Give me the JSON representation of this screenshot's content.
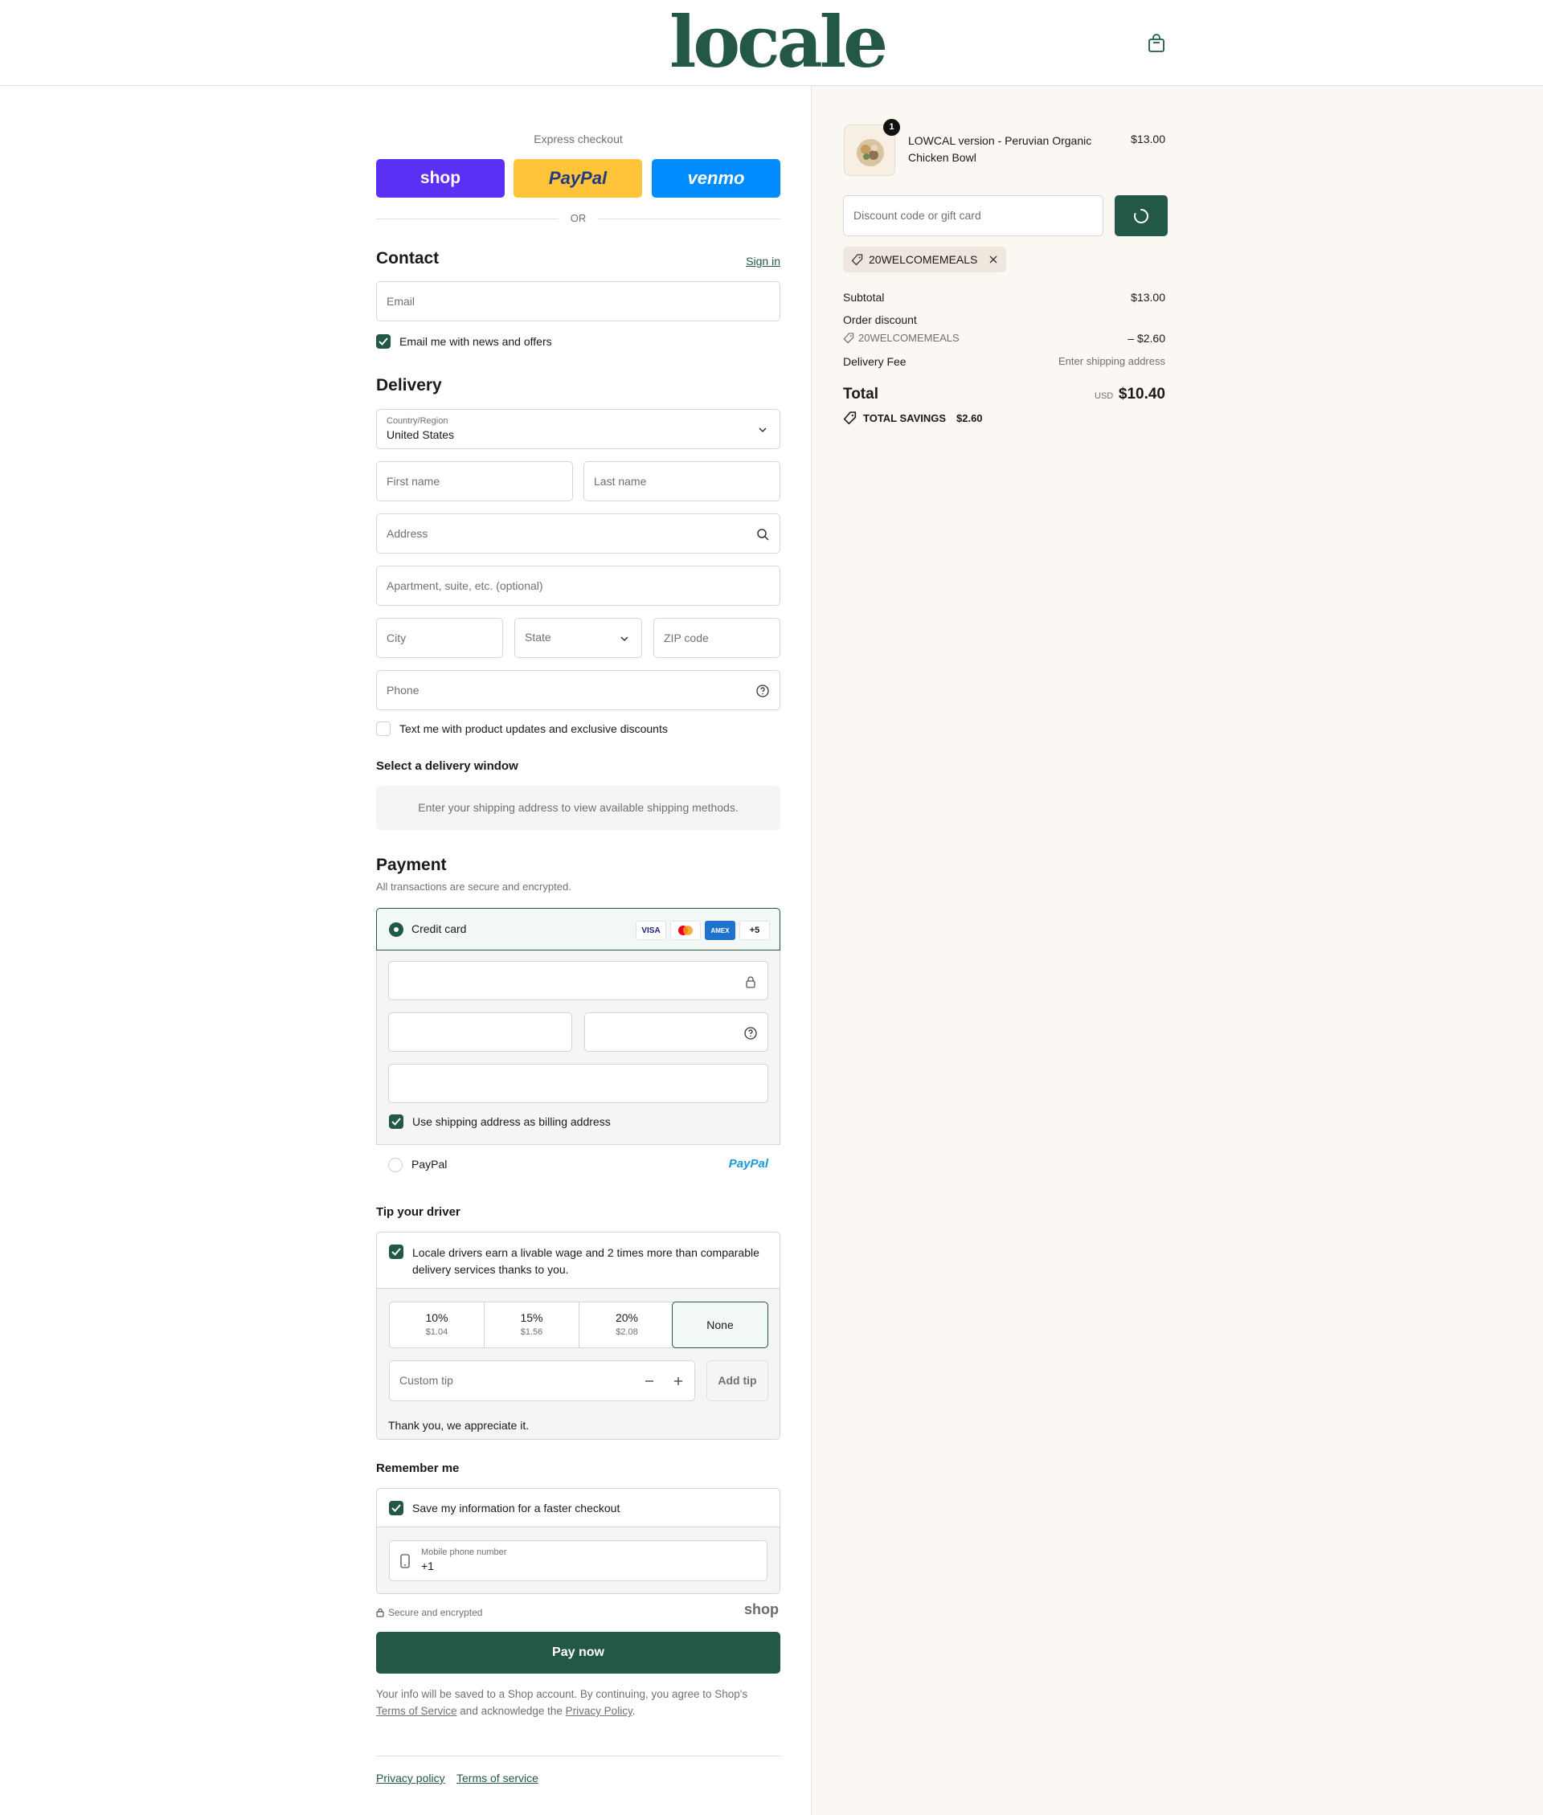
{
  "header": {
    "logo": "locale",
    "cart_icon": "shopping-bag-icon"
  },
  "express": {
    "label": "Express checkout",
    "shop": "shop",
    "paypal": "PayPal",
    "venmo": "venmo",
    "or": "OR"
  },
  "contact": {
    "title": "Contact",
    "sign_in": "Sign in",
    "email_placeholder": "Email",
    "news_label": "Email me with news and offers",
    "news_checked": true
  },
  "delivery": {
    "title": "Delivery",
    "country_label": "Country/Region",
    "country_value": "United States",
    "first_name": "First name",
    "last_name": "Last name",
    "address": "Address",
    "apartment": "Apartment, suite, etc. (optional)",
    "city": "City",
    "state": "State",
    "zip": "ZIP code",
    "phone": "Phone",
    "text_label": "Text me with product updates and exclusive discounts",
    "window_title": "Select a delivery window",
    "window_notice": "Enter your shipping address to view available shipping methods."
  },
  "payment": {
    "title": "Payment",
    "subtitle": "All transactions are secure and encrypted.",
    "credit_card": "Credit card",
    "card_logos": [
      "VISA",
      "AMEX",
      "+5"
    ],
    "billing_label": "Use shipping address as billing address",
    "paypal_label": "PayPal",
    "paypal_logo": "PayPal"
  },
  "tip": {
    "title": "Tip your driver",
    "message": "Locale drivers earn a livable wage and 2 times more than comparable delivery services thanks to you.",
    "options": [
      {
        "pct": "10%",
        "amt": "$1.04"
      },
      {
        "pct": "15%",
        "amt": "$1.56"
      },
      {
        "pct": "20%",
        "amt": "$2.08"
      }
    ],
    "none": "None",
    "custom_placeholder": "Custom tip",
    "add_tip": "Add tip",
    "thanks": "Thank you, we appreciate it."
  },
  "remember": {
    "title": "Remember me",
    "save_label": "Save my information for a faster checkout",
    "phone_label": "Mobile phone number",
    "phone_value": "+1"
  },
  "footer": {
    "secure": "Secure and encrypted",
    "shop_logo": "shop",
    "pay_now": "Pay now",
    "legal_prefix": "Your info will be saved to a Shop account. By continuing, you agree to Shop's",
    "terms": "Terms of Service",
    "legal_mid": "and acknowledge the",
    "privacy": "Privacy Policy",
    "privacy_policy_link": "Privacy policy",
    "terms_link": "Terms of service"
  },
  "summary": {
    "qty": "1",
    "product_name": "LOWCAL version - Peruvian Organic Chicken Bowl",
    "product_price": "$13.00",
    "discount_placeholder": "Discount code or gift card",
    "applied_code": "20WELCOMEMEALS",
    "subtotal_label": "Subtotal",
    "subtotal_value": "$13.00",
    "order_discount_label": "Order discount",
    "discount_code": "20WELCOMEMEALS",
    "discount_value": "– $2.60",
    "delivery_label": "Delivery Fee",
    "delivery_value": "Enter shipping address",
    "total_label": "Total",
    "currency": "USD",
    "total_value": "$10.40",
    "savings_label": "TOTAL SAVINGS",
    "savings_value": "$2.60"
  },
  "colors": {
    "brand": "#235849",
    "shop": "#5a31f4",
    "paypal": "#ffc439",
    "venmo": "#008cff",
    "summary_bg": "#fbf7f2"
  }
}
